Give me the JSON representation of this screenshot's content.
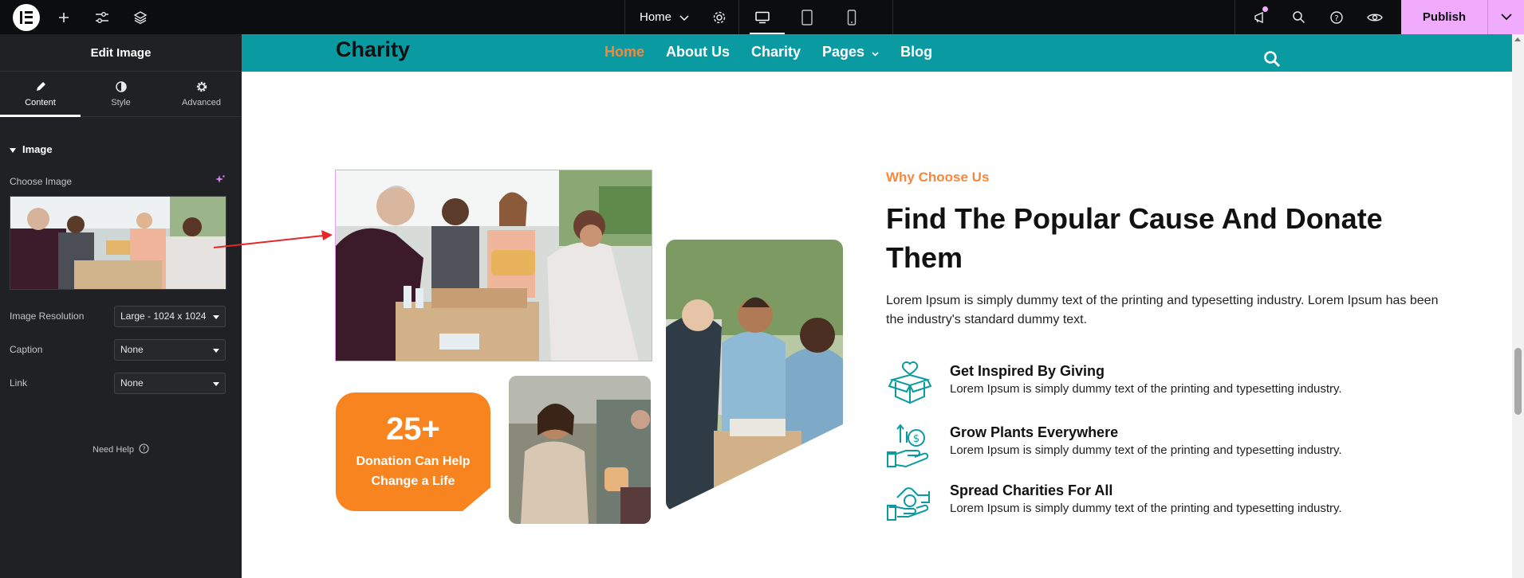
{
  "topbar": {
    "page_label": "Home",
    "publish_label": "Publish",
    "colors": {
      "bar": "#0c0d0e",
      "publish": "#f0abfc"
    },
    "icons": [
      "elementor-logo-icon",
      "plus-icon",
      "sliders-icon",
      "layers-icon",
      "chevron-down-icon",
      "gear-icon",
      "desktop-icon",
      "tablet-icon",
      "mobile-icon",
      "megaphone-icon",
      "search-icon",
      "help-icon",
      "eye-icon"
    ]
  },
  "panel": {
    "title": "Edit Image",
    "tabs": [
      {
        "label": "Content",
        "icon": "pencil-icon",
        "active": true
      },
      {
        "label": "Style",
        "icon": "contrast-icon",
        "active": false
      },
      {
        "label": "Advanced",
        "icon": "gear-icon",
        "active": false
      }
    ],
    "section_title": "Image",
    "choose_image_label": "Choose Image",
    "fields": [
      {
        "label": "Image Resolution",
        "value": "Large - 1024 x 1024"
      },
      {
        "label": "Caption",
        "value": "None"
      },
      {
        "label": "Link",
        "value": "None"
      }
    ],
    "need_help": "Need Help"
  },
  "site": {
    "brand": "Charity",
    "menu": [
      {
        "label": "Home",
        "active": true
      },
      {
        "label": "About Us",
        "active": false
      },
      {
        "label": "Charity",
        "active": false
      },
      {
        "label": "Pages",
        "active": false,
        "has_dropdown": true
      },
      {
        "label": "Blog",
        "active": false
      }
    ],
    "colors": {
      "nav": "#0a9aa2",
      "accent": "#f7883b",
      "card": "#f7841f"
    }
  },
  "content": {
    "stat_number": "25+",
    "stat_text_1": "Donation Can Help",
    "stat_text_2": "Change a Life",
    "eyebrow": "Why Choose Us",
    "heading": "Find The Popular Cause And Donate Them",
    "paragraph": "Lorem Ipsum is simply dummy text of the printing and typesetting industry. Lorem Ipsum has been the industry's standard dummy text.",
    "features": [
      {
        "title": "Get Inspired By Giving",
        "desc": "Lorem Ipsum is simply dummy text of the printing and typesetting industry.",
        "icon": "gift-box-heart-icon"
      },
      {
        "title": "Grow Plants Everywhere",
        "desc": "Lorem Ipsum is simply dummy text of the printing and typesetting industry.",
        "icon": "coin-hand-icon"
      },
      {
        "title": "Spread Charities For All",
        "desc": "Lorem Ipsum is simply dummy text of the printing and typesetting industry.",
        "icon": "hand-giving-icon"
      }
    ]
  }
}
